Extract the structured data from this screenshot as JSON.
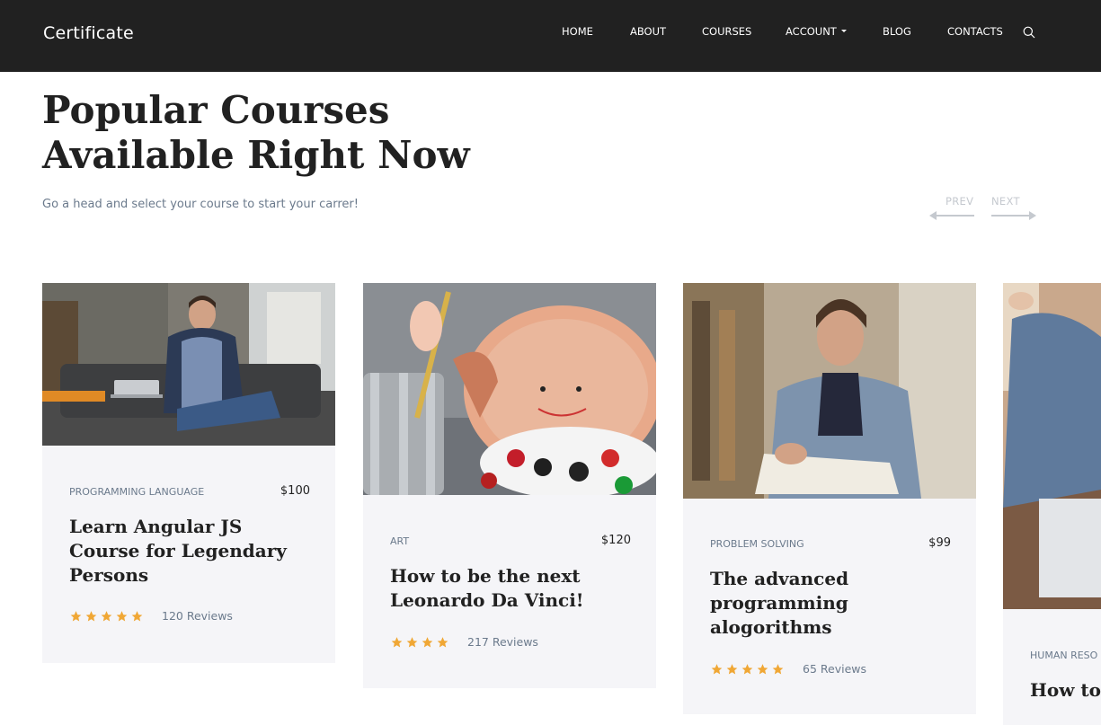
{
  "brand": {
    "name": "Certificate"
  },
  "nav": {
    "items": [
      {
        "label": "HOME"
      },
      {
        "label": "ABOUT"
      },
      {
        "label": "COURSES"
      },
      {
        "label": "ACCOUNT",
        "has_dropdown": true
      },
      {
        "label": "BLOG"
      },
      {
        "label": "CONTACTS"
      }
    ],
    "search_icon": "search-icon"
  },
  "hero": {
    "title_line1": "Popular Courses",
    "title_line2": "Available Right Now",
    "subtitle": "Go a head and select your course to start your carrer!",
    "prev_label": "PREV",
    "next_label": "NEXT"
  },
  "colors": {
    "header_bg": "#212121",
    "card_bg": "#f5f5f8",
    "star": "#f0a735",
    "muted_text": "#6b7a8c",
    "arrow": "#c5c9cf"
  },
  "courses": [
    {
      "category": "PROGRAMMING LANGUAGE",
      "price": "$100",
      "title": "Learn Angular JS Course for Legendary Persons",
      "rating": 5,
      "reviews": "120 Reviews"
    },
    {
      "category": "ART",
      "price": "$120",
      "title": "How to be the next Leonardo Da Vinci!",
      "rating": 4,
      "reviews": "217 Reviews"
    },
    {
      "category": "PROBLEM SOLVING",
      "price": "$99",
      "title": "The advanced programming alogorithms",
      "rating": 5,
      "reviews": "65 Reviews"
    },
    {
      "category": "HUMAN RESO",
      "price": "",
      "title": "How to employ",
      "rating": 0,
      "reviews": ""
    }
  ]
}
